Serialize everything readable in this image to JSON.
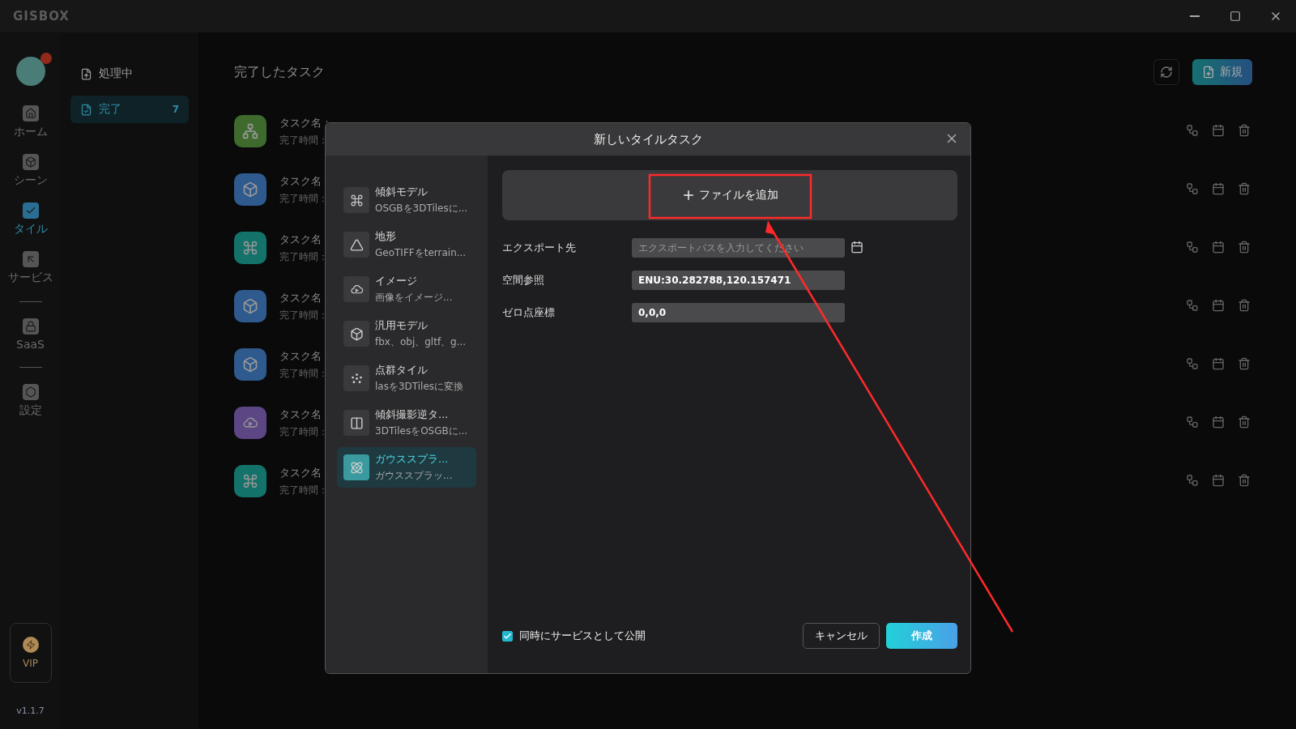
{
  "app": {
    "logo": "GISBOX",
    "version": "v1.1.7",
    "vip": "VIP"
  },
  "nav": [
    [
      {
        "label": "ホーム",
        "kind": "home",
        "selected": false
      },
      {
        "label": "シーン",
        "kind": "scene",
        "selected": false
      },
      {
        "label": "タイル",
        "kind": "tile",
        "selected": true
      },
      {
        "label": "サービス",
        "kind": "service",
        "selected": false
      }
    ],
    [
      {
        "label": "SaaS",
        "kind": "lock",
        "selected": false
      }
    ],
    [
      {
        "label": "設定",
        "kind": "settings",
        "selected": false
      }
    ]
  ],
  "sidebar": [
    {
      "label": "処理中",
      "kind": "upload",
      "selected": false
    },
    {
      "label": "完了",
      "kind": "check",
      "count": "7",
      "selected": true
    }
  ],
  "main": {
    "title": "完了したタスク",
    "new_button": "新規"
  },
  "tasks": [
    {
      "name_label": "タスク名：",
      "time_label": "完了時間：",
      "kind": "network",
      "color": "#3e6a2e"
    },
    {
      "name_label": "タスク名",
      "time_label": "完了時間：",
      "kind": "box",
      "color": "#2e5a8e"
    },
    {
      "name_label": "タスク名",
      "time_label": "完了時間：",
      "kind": "drone",
      "color": "#13736b"
    },
    {
      "name_label": "タスク名",
      "time_label": "完了時間：",
      "kind": "box",
      "color": "#2e5a8e"
    },
    {
      "name_label": "タスク名",
      "time_label": "完了時間：",
      "kind": "box",
      "color": "#2e5a8e"
    },
    {
      "name_label": "タスク名",
      "time_label": "完了時間：",
      "kind": "cloud",
      "color": "#5c4784"
    },
    {
      "name_label": "タスク名",
      "time_label": "完了時間：",
      "kind": "drone",
      "color": "#13736b"
    }
  ],
  "dialog": {
    "title": "新しいタイルタスク",
    "types": [
      {
        "title": "傾斜モデル",
        "subtitle": "OSGBを3DTilesに...",
        "kind": "drone",
        "selected": false
      },
      {
        "title": "地形",
        "subtitle": "GeoTIFFをterrain...",
        "kind": "terrain",
        "selected": false
      },
      {
        "title": "イメージ",
        "subtitle": "画像をイメージ...",
        "kind": "cloud",
        "selected": false
      },
      {
        "title": "汎用モデル",
        "subtitle": "fbx、obj、gltf、g...",
        "kind": "box",
        "selected": false
      },
      {
        "title": "点群タイル",
        "subtitle": "lasを3DTilesに変換",
        "kind": "points",
        "selected": false
      },
      {
        "title": "傾斜撮影逆タ...",
        "subtitle": "3DTilesをOSGBに...",
        "kind": "convert",
        "selected": false
      },
      {
        "title": "ガウススプラ...",
        "subtitle": "ガウススプラッ...",
        "kind": "atom",
        "selected": true
      }
    ],
    "add_file": "ファイルを追加",
    "fields": [
      {
        "label": "エクスポート先",
        "placeholder": "エクスポートパスを入力してください",
        "browse": true
      },
      {
        "label": "空間参照",
        "value": "ENU:30.282788,120.157471",
        "browse": false
      },
      {
        "label": "ゼロ点座標",
        "value": "0,0,0",
        "browse": false
      }
    ],
    "publish": {
      "label": "同時にサービスとして公開",
      "checked": true
    },
    "cancel": "キャンセル",
    "create": "作成"
  }
}
